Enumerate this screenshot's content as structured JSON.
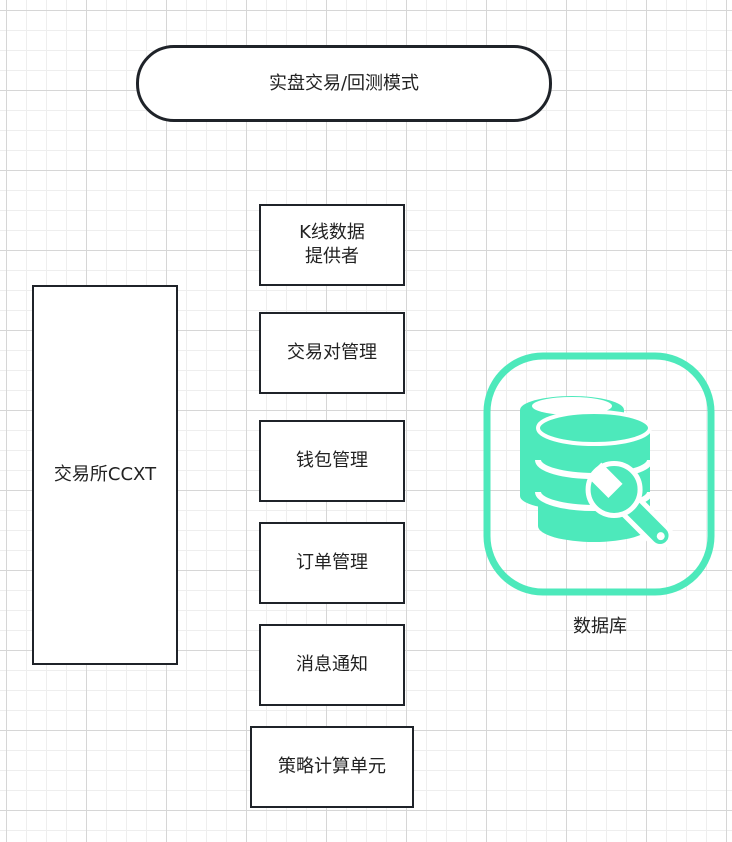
{
  "nodes": {
    "mode": "实盘交易/回测模式",
    "exchange": "交易所CCXT",
    "kline": "K线数据\n提供者",
    "pair": "交易对管理",
    "wallet": "钱包管理",
    "order": "订单管理",
    "message": "消息通知",
    "strategy": "策略计算单元"
  },
  "database": {
    "label": "数据库",
    "icon": "database-wrench-icon",
    "color": "#4de9bb"
  }
}
